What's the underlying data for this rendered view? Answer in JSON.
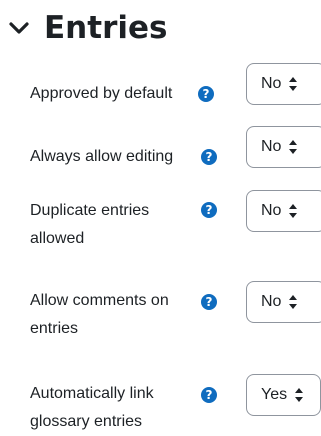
{
  "section": {
    "title": "Entries",
    "collapse_icon": "chevron-down-icon"
  },
  "settings": [
    {
      "label_lines": [
        "Approved by default"
      ],
      "help_icon": "question-circle-icon",
      "value": "No"
    },
    {
      "label_lines": [
        "Always allow editing"
      ],
      "help_icon": "question-circle-icon",
      "value": "No"
    },
    {
      "label_lines": [
        "Duplicate entries",
        "allowed"
      ],
      "help_icon": "question-circle-icon",
      "value": "No"
    },
    {
      "label_lines": [
        "Allow comments on",
        "entries"
      ],
      "help_icon": "question-circle-icon",
      "value": "No"
    },
    {
      "label_lines": [
        "Automatically link",
        "glossary entries"
      ],
      "help_icon": "question-circle-icon",
      "value": "Yes"
    }
  ],
  "colors": {
    "text": "#1d2125",
    "help_icon": "#0f6cbf",
    "select_border": "#8f959e"
  }
}
